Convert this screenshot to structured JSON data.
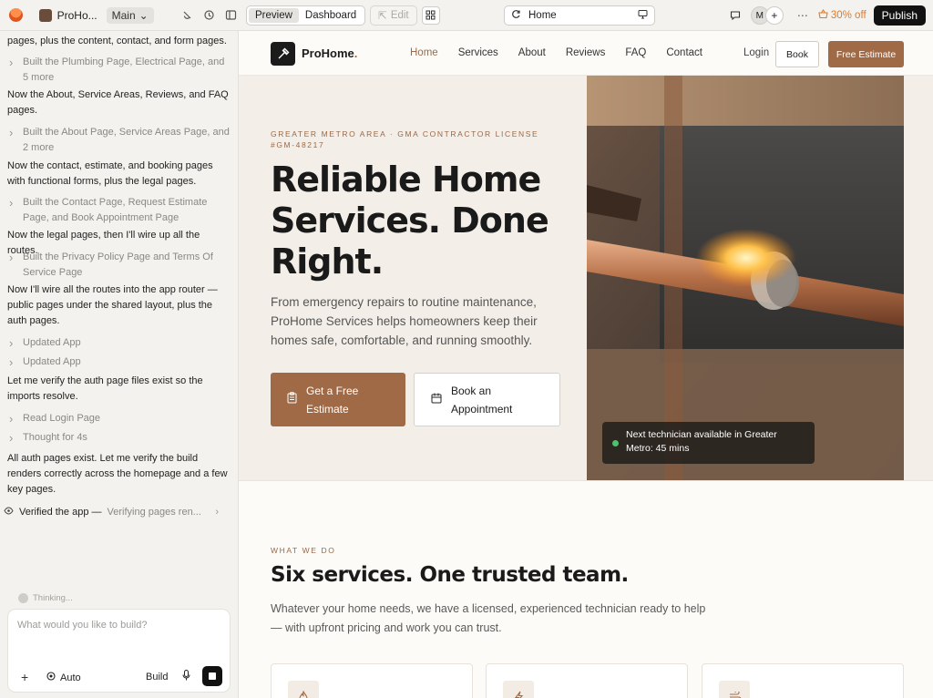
{
  "topbar": {
    "project_name": "ProHo...",
    "branch": "Main",
    "preview_tab": "Preview",
    "dashboard_tab": "Dashboard",
    "edit_label": "Edit",
    "url": "Home",
    "avatar_initial": "M",
    "discount": "30% off",
    "publish": "Publish"
  },
  "chat": {
    "messages": [
      "pages, plus the content, contact, and form pages.",
      "Now the About, Service Areas, Reviews, and FAQ pages.",
      "Now the contact, estimate, and booking pages with functional forms, plus the legal pages.",
      "Now the legal pages, then I'll wire up all the routes.",
      "Now I'll wire all the routes into the app router — public pages under the shared layout, plus the auth pages.",
      "Let me verify the auth page files exist so the imports resolve.",
      "All auth pages exist. Let me verify the build renders correctly across the homepage and a few key pages."
    ],
    "steps": [
      "Built the Plumbing Page, Electrical Page, and 5 more",
      "Built the About Page, Service Areas Page, and 2 more",
      "Built the Contact Page, Request Estimate Page, and Book Appointment Page",
      "Built the Privacy Policy Page and Terms Of Service Page",
      "Updated App",
      "Updated App",
      "Read Login Page",
      "Thought for 4s"
    ],
    "verified_label": "Verified the app —",
    "verified_detail": "Verifying pages ren...",
    "thinking": "Thinking...",
    "composer_placeholder": "What would you like to build?",
    "mode": "Auto",
    "build": "Build"
  },
  "site": {
    "logo": "ProHome",
    "logo_dot": ".",
    "nav": [
      "Home",
      "Services",
      "About",
      "Reviews",
      "FAQ",
      "Contact"
    ],
    "login": "Login",
    "book": "Book",
    "free_estimate": "Free Estimate",
    "hero": {
      "eyebrow": "GREATER METRO AREA · GMA CONTRACTOR LICENSE #GM-48217",
      "title": "Reliable Home Services. Done Right.",
      "subtitle": "From emergency repairs to routine maintenance, ProHome Services helps homeowners keep their homes safe, comfortable, and running smoothly.",
      "cta_primary": "Get a Free Estimate",
      "cta_secondary": "Book an Appointment",
      "availability": "Next technician available in Greater Metro: 45 mins"
    },
    "services": {
      "eyebrow": "WHAT WE DO",
      "title": "Six services. One trusted team.",
      "subtitle": "Whatever your home needs, we have a licensed, experienced technician ready to help — with upfront pricing and work you can trust."
    },
    "colors": {
      "accent": "#a06a46",
      "publish_bg": "#111111",
      "discount": "#e07a2b",
      "status_green": "#4cc26a"
    }
  }
}
